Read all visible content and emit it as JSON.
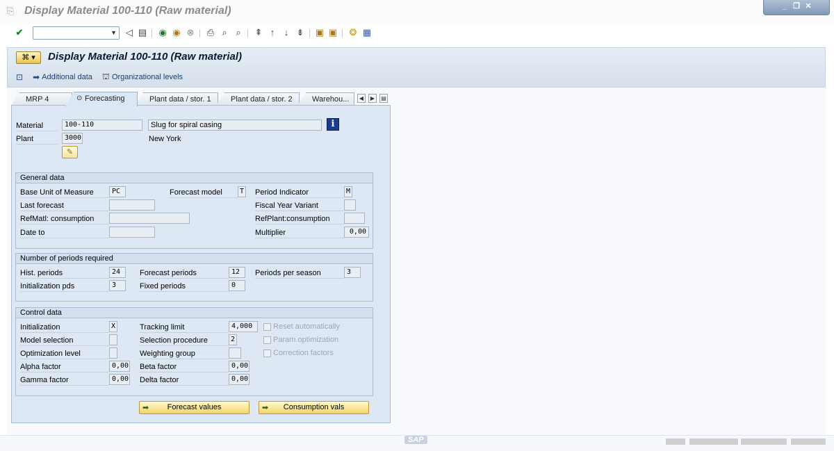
{
  "window": {
    "title": "Display Material 100-110 (Raw material)"
  },
  "header": {
    "title": "Display Material 100-110 (Raw material)",
    "buttons": {
      "additional_data": "Additional data",
      "org_levels": "Organizational levels"
    }
  },
  "tabs": [
    "MRP 4",
    "Forecasting",
    "Plant data / stor. 1",
    "Plant data / stor. 2",
    "Warehou..."
  ],
  "active_tab": "Forecasting",
  "material": {
    "material_label": "Material",
    "material_value": "100-110",
    "description": "Slug for spiral casing",
    "plant_label": "Plant",
    "plant_value": "3000",
    "plant_name": "New York"
  },
  "general": {
    "title": "General data",
    "base_uom_label": "Base Unit of Measure",
    "base_uom": "PC",
    "forecast_model_label": "Forecast model",
    "forecast_model": "T",
    "period_indicator_label": "Period Indicator",
    "period_indicator": "M",
    "last_forecast_label": "Last forecast",
    "last_forecast": "",
    "fiscal_year_variant_label": "Fiscal Year Variant",
    "fiscal_year_variant": "",
    "refmatl_label": "RefMatl: consumption",
    "refmatl": "",
    "refplant_label": "RefPlant:consumption",
    "refplant": "",
    "date_to_label": "Date to",
    "date_to": "",
    "multiplier_label": "Multiplier",
    "multiplier": "0,00"
  },
  "periods": {
    "title": "Number of periods required",
    "hist_label": "Hist. periods",
    "hist": "24",
    "forecast_label": "Forecast periods",
    "forecast": "12",
    "per_season_label": "Periods per season",
    "per_season": "3",
    "init_label": "Initialization pds",
    "init": "3",
    "fixed_label": "Fixed periods",
    "fixed": "0"
  },
  "control": {
    "title": "Control data",
    "initialization_label": "Initialization",
    "initialization": "X",
    "tracking_label": "Tracking limit",
    "tracking": "4,000",
    "reset_label": "Reset automatically",
    "model_sel_label": "Model selection",
    "model_sel": "",
    "sel_proc_label": "Selection procedure",
    "sel_proc": "2",
    "param_opt_label": "Param.optimization",
    "opt_level_label": "Optimization level",
    "opt_level": "",
    "weighting_label": "Weighting group",
    "weighting": "",
    "corr_label": "Correction factors",
    "alpha_label": "Alpha factor",
    "alpha": "0,00",
    "beta_label": "Beta factor",
    "beta": "0,00",
    "gamma_label": "Gamma factor",
    "gamma": "0,00",
    "delta_label": "Delta factor",
    "delta": "0,00"
  },
  "footer_buttons": {
    "forecast_values": "Forecast values",
    "consumption_vals": "Consumption vals"
  },
  "status": {
    "logo": "SAP"
  },
  "colors": {
    "panel": "#dde8f4",
    "header": "#d5e0ec",
    "yellow_button": "#f3d56a",
    "title_text": "#8b8b8b"
  }
}
